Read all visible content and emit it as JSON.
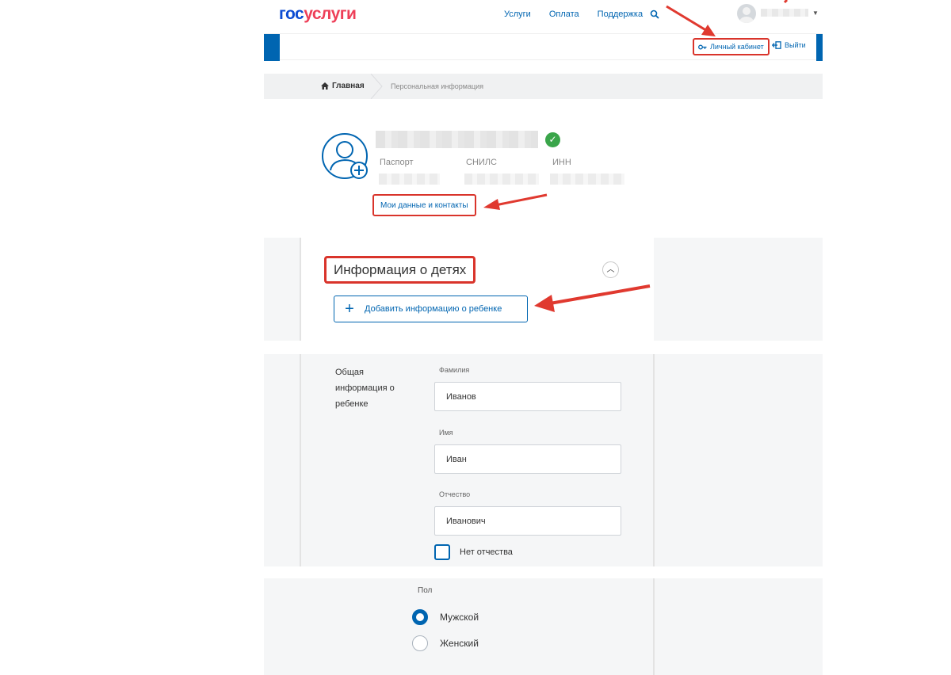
{
  "header": {
    "logo_part1": "гос",
    "logo_part2": "услуги",
    "nav": [
      "Услуги",
      "Оплата",
      "Поддержка"
    ],
    "cabinet_label": "Личный кабинет",
    "logout_label": "Выйти"
  },
  "breadcrumb": {
    "home": "Главная",
    "current": "Персональная информация"
  },
  "profile": {
    "doc_labels": {
      "passport": "Паспорт",
      "snils": "СНИЛС",
      "inn": "ИНН"
    },
    "my_data_link": "Мои данные и контакты"
  },
  "children": {
    "title": "Информация о детях",
    "add_button": "Добавить информацию о ребенке"
  },
  "child_form": {
    "section_label": "Общая информация о ребенке",
    "surname_label": "Фамилия",
    "surname_value": "Иванов",
    "name_label": "Имя",
    "name_value": "Иван",
    "patronymic_label": "Отчество",
    "patronymic_value": "Иванович",
    "no_patronymic_label": "Нет отчества",
    "gender_label": "Пол",
    "gender_options": [
      "Мужской",
      "Женский"
    ],
    "gender_selected": "Мужской"
  },
  "colors": {
    "brand_blue": "#0065b1",
    "brand_red": "#ee3f58",
    "annotation_red": "#d9342b",
    "verified_green": "#3aa54a"
  }
}
